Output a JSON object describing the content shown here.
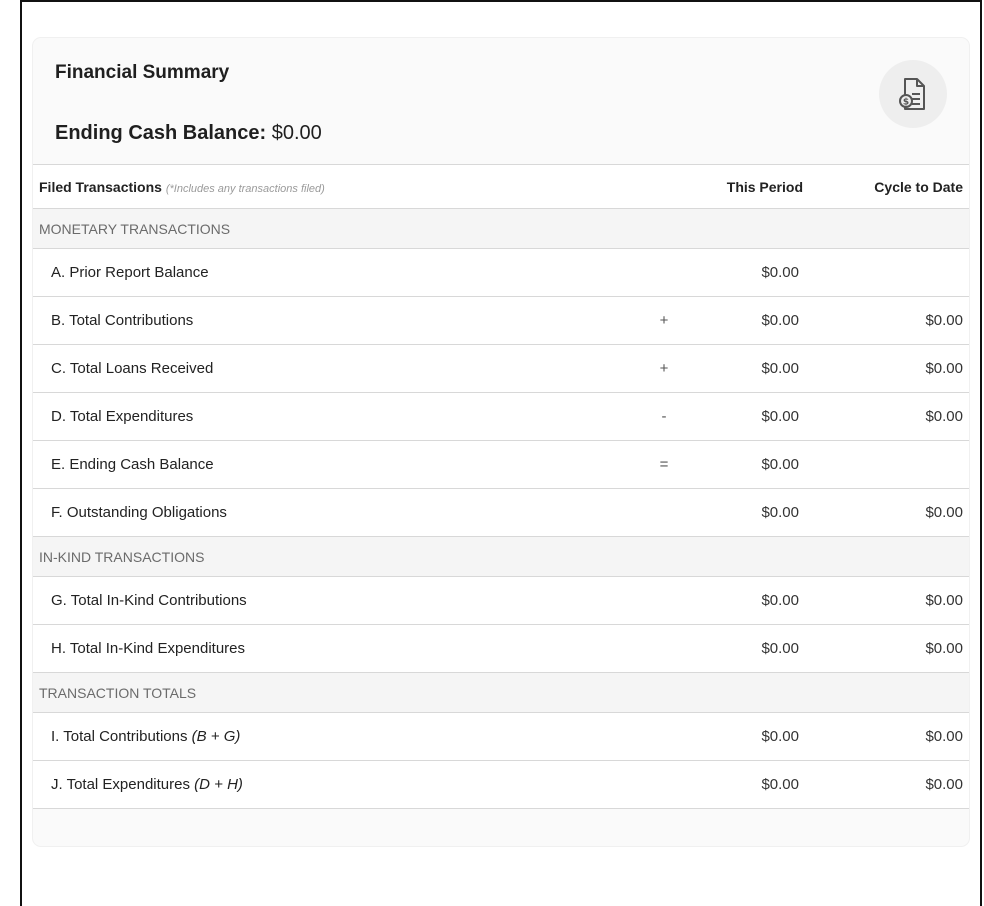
{
  "summary": {
    "title": "Financial Summary",
    "ending_balance_label": "Ending Cash Balance:",
    "ending_balance_value": "$0.00",
    "icon": "receipt-dollar-icon"
  },
  "table": {
    "headers": {
      "label": "Filed Transactions",
      "note": "(*Includes any transactions filed)",
      "this_period": "This Period",
      "cycle_to_date": "Cycle to Date"
    },
    "sections": [
      {
        "title": "MONETARY TRANSACTIONS",
        "rows": [
          {
            "label": "A. Prior Report Balance",
            "op": "",
            "this_period": "$0.00",
            "cycle": ""
          },
          {
            "label": "B. Total Contributions",
            "op": "+",
            "this_period": "$0.00",
            "cycle": "$0.00"
          },
          {
            "label": "C. Total Loans Received",
            "op": "+",
            "this_period": "$0.00",
            "cycle": "$0.00"
          },
          {
            "label": "D. Total Expenditures",
            "op": "-",
            "this_period": "$0.00",
            "cycle": "$0.00"
          },
          {
            "label": "E. Ending Cash Balance",
            "op": "=",
            "this_period": "$0.00",
            "cycle": ""
          },
          {
            "label": "F. Outstanding Obligations",
            "op": "",
            "this_period": "$0.00",
            "cycle": "$0.00"
          }
        ]
      },
      {
        "title": "IN-KIND TRANSACTIONS",
        "rows": [
          {
            "label": "G. Total In-Kind Contributions",
            "op": "",
            "this_period": "$0.00",
            "cycle": "$0.00"
          },
          {
            "label": "H. Total In-Kind Expenditures",
            "op": "",
            "this_period": "$0.00",
            "cycle": "$0.00"
          }
        ]
      },
      {
        "title": "TRANSACTION TOTALS",
        "rows": [
          {
            "label": "I. Total Contributions",
            "formula": "(B + G)",
            "op": "",
            "this_period": "$0.00",
            "cycle": "$0.00"
          },
          {
            "label": "J. Total Expenditures",
            "formula": "(D + H)",
            "op": "",
            "this_period": "$0.00",
            "cycle": "$0.00"
          }
        ]
      }
    ]
  }
}
